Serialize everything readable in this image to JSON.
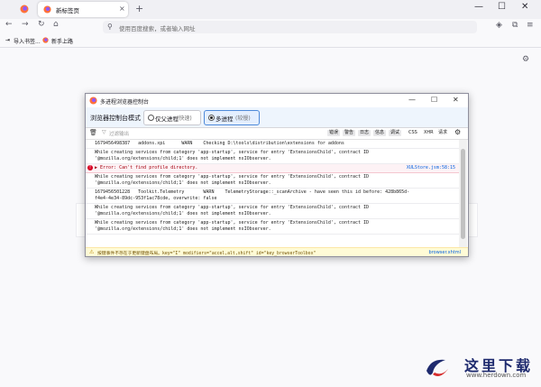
{
  "browser": {
    "tab_title": "新标签页",
    "tab_close": "×",
    "new_tab": "+",
    "url_placeholder": "使用百度搜索，或者输入网址",
    "bookmarks": [
      "导入书签...",
      "新手上路"
    ],
    "window_controls": [
      "—",
      "☐",
      "✕"
    ]
  },
  "console": {
    "title": "多进程浏览器控制台",
    "mode_label": "浏览器控制台模式",
    "modes": [
      {
        "name": "仅父进程",
        "hint": "(快速)",
        "selected": false
      },
      {
        "name": "多进程",
        "hint": "(较慢)",
        "selected": true
      }
    ],
    "filter_placeholder": "过滤输出",
    "filter_buttons": [
      "错误",
      "警告",
      "日志",
      "信息",
      "调试"
    ],
    "filter_types": [
      "CSS",
      "XHR",
      "请求"
    ],
    "rows": [
      {
        "text": "1679456498387   addons.xpi      WARN    Checking D:\\tools\\distribution\\extensions for addons",
        "type": "log",
        "source": ""
      },
      {
        "text": "While creating services from category 'app-startup', service for entry 'ExtensionsChild', contract ID '@mozilla.org/extensions/child;1' does not implement nsIObserver.",
        "type": "log",
        "source": ""
      },
      {
        "text": "▶ Error: Can't find profile directory.",
        "type": "error",
        "source": "XULStore.jsm:58:15"
      },
      {
        "text": "While creating services from category 'app-startup', service for entry 'ExtensionsChild', contract ID '@mozilla.org/extensions/child;1' does not implement nsIObserver.",
        "type": "log",
        "source": ""
      },
      {
        "text": "1679456501228   Toolkit.Telemetry       WARN    TelemetryStorage::_scanArchive - have seen this id before: 428b865d-f4e4-4e34-89dc-953f1ac78cde, overwrite: false",
        "type": "log",
        "source": ""
      },
      {
        "text": "While creating services from category 'app-startup', service for entry 'ExtensionsChild', contract ID '@mozilla.org/extensions/child;1' does not implement nsIObserver.",
        "type": "log",
        "source": ""
      },
      {
        "text": "While creating services from category 'app-startup', service for entry 'ExtensionsChild', contract ID '@mozilla.org/extensions/child;1' does not implement nsIObserver.",
        "type": "log",
        "source": ""
      }
    ],
    "warning": {
      "text": "按键事件不存在于更新键盘布局。key=\"I\" modifiers=\"accel,alt,shift\" id=\"key_browserToolbox\"",
      "source": "browser.xhtml"
    }
  },
  "watermark": {
    "text": "这里下载",
    "url": "www.herdown.com"
  }
}
